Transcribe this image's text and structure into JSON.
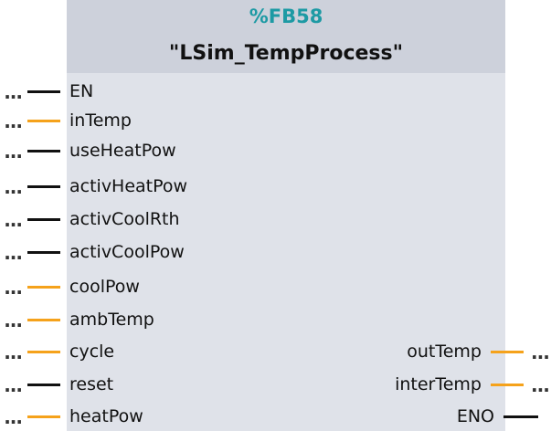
{
  "block": {
    "instance_id": "%FB58",
    "name": "\"LSim_TempProcess\""
  },
  "colors": {
    "bool_wire": "#111111",
    "real_wire": "#f5a21b",
    "instance_id": "#1d9aa4",
    "block_body": "#dfe2e9"
  },
  "inputs": [
    {
      "label": "EN",
      "wire": "bool",
      "connection": "..."
    },
    {
      "label": "inTemp",
      "wire": "real",
      "connection": "..."
    },
    {
      "label": "useHeatPow",
      "wire": "bool",
      "connection": "..."
    },
    {
      "label": "activHeatPow",
      "wire": "bool",
      "connection": "..."
    },
    {
      "label": "activCoolRth",
      "wire": "bool",
      "connection": "..."
    },
    {
      "label": "activCoolPow",
      "wire": "bool",
      "connection": "..."
    },
    {
      "label": "coolPow",
      "wire": "real",
      "connection": "..."
    },
    {
      "label": "ambTemp",
      "wire": "real",
      "connection": "..."
    },
    {
      "label": "cycle",
      "wire": "real",
      "connection": "..."
    },
    {
      "label": "reset",
      "wire": "bool",
      "connection": "..."
    },
    {
      "label": "heatPow",
      "wire": "real",
      "connection": "..."
    }
  ],
  "outputs": [
    {
      "label": "outTemp",
      "wire": "real",
      "connection": "..."
    },
    {
      "label": "interTemp",
      "wire": "real",
      "connection": "..."
    },
    {
      "label": "ENO",
      "wire": "bool",
      "connection": ""
    }
  ]
}
